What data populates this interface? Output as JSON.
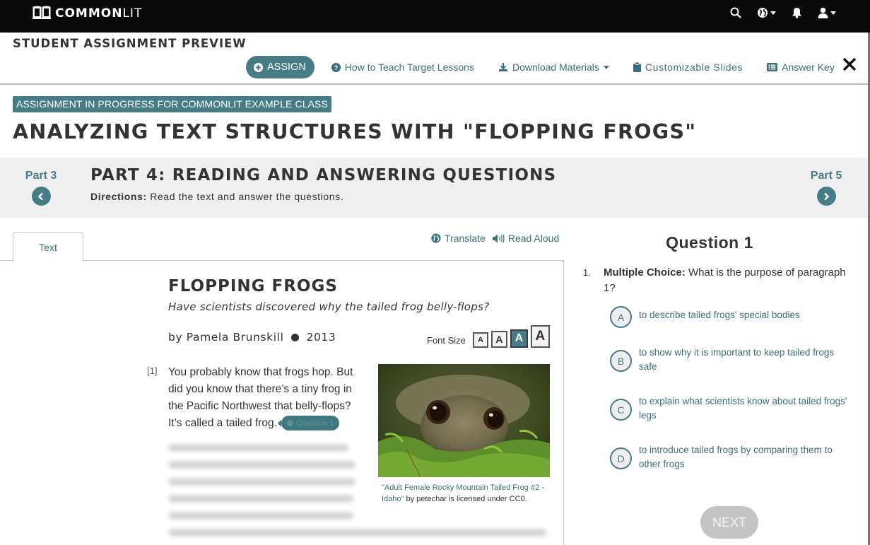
{
  "topbar": {
    "logo_bold": "COMMON",
    "logo_light": "LIT",
    "icons": [
      "search-icon",
      "globe-icon",
      "bell-icon",
      "user-icon"
    ]
  },
  "preview": {
    "title": "STUDENT ASSIGNMENT PREVIEW",
    "assign_label": "ASSIGN",
    "how_to_teach_label": "How to Teach Target Lessons",
    "download_label": "Download Materials",
    "slides_label": "Customizable Slides",
    "answer_key_label": "Answer Key"
  },
  "assignment": {
    "badge": "ASSIGNMENT IN PROGRESS FOR COMMONLIT EXAMPLE CLASS",
    "title": "ANALYZING TEXT STRUCTURES WITH \"FLOPPING FROGS\""
  },
  "part": {
    "prev_label": "Part 3",
    "next_label": "Part 5",
    "title": "PART 4: READING AND ANSWERING QUESTIONS",
    "directions_label": "Directions:",
    "directions_text": "Read the text and answer the questions."
  },
  "text_panel": {
    "tab_label": "Text",
    "translate_label": "Translate",
    "read_aloud_label": "Read Aloud",
    "title": "FLOPPING FROGS",
    "subtitle": "Have scientists discovered why the tailed frog belly-flops?",
    "author": "by Pamela Brunskill",
    "year": "2013",
    "font_size_label": "Font Size",
    "font_size_options": [
      "A",
      "A",
      "A",
      "A"
    ],
    "font_size_selected_index": 2,
    "paragraph_number": "[1]",
    "paragraph_text": "You probably know that frogs hop. But did you know that there’s a tiny frog in the Pacific Northwest that belly-flops? It’s called a tailed frog.",
    "question_marker_label": "Question 1",
    "image_caption_link": "\"Adult Female Rocky Mountain Tailed Frog #2 - Idaho\"",
    "image_caption_rest": " by petechar is licensed under CC0."
  },
  "question_panel": {
    "heading": "Question 1",
    "number": "1.",
    "type_label": "Multiple Choice:",
    "prompt": " What is the purpose of paragraph 1?",
    "choices": [
      {
        "letter": "A",
        "text": "to describe tailed frogs' special bodies"
      },
      {
        "letter": "B",
        "text": "to show why it is important to keep tailed frogs safe"
      },
      {
        "letter": "C",
        "text": "to explain what scientists know about tailed frogs' legs"
      },
      {
        "letter": "D",
        "text": "to introduce tailed frogs by comparing them to other frogs"
      }
    ],
    "next_label": "NEXT"
  },
  "colors": {
    "brand_teal": "#467c86",
    "link_teal": "#3a6e78",
    "topbar": "#0a0a0a",
    "partbar": "#efefef",
    "next_disabled": "#c4c4c4"
  }
}
